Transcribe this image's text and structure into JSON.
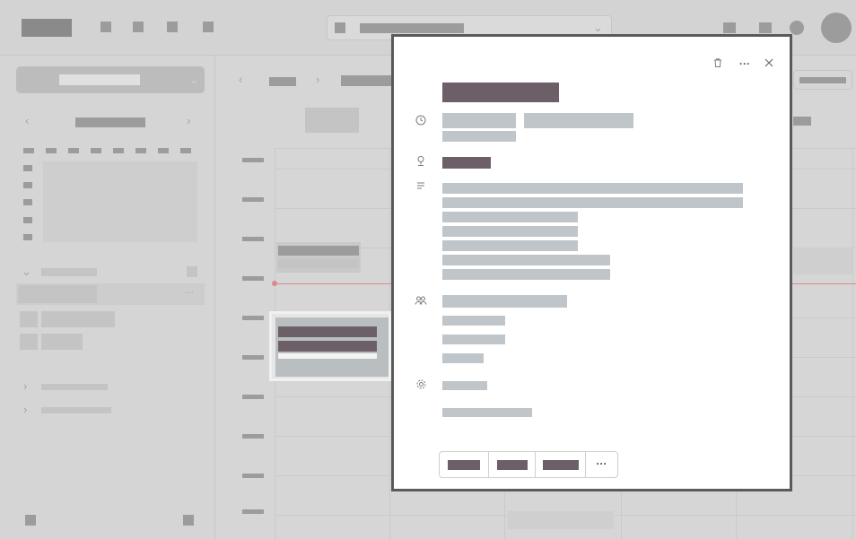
{
  "popup": {
    "header_icons": {
      "delete": "trash-icon",
      "more": "more-icon",
      "close": "close-icon"
    },
    "title": "",
    "time": {
      "icon": "clock-icon",
      "start": "",
      "end": "",
      "recurrence": ""
    },
    "location": {
      "icon": "location-pin-icon",
      "value": ""
    },
    "description": {
      "icon": "notes-icon",
      "lines": [
        "",
        "",
        "",
        "",
        "",
        "",
        ""
      ]
    },
    "attendees": {
      "icon": "people-icon",
      "summary": "",
      "names": [
        "",
        "",
        ""
      ]
    },
    "settings": {
      "icon": "gear-icon",
      "value": "",
      "secondary": ""
    },
    "rsvp": {
      "options": [
        "",
        "",
        ""
      ],
      "more_icon": "more-icon"
    }
  },
  "colors": {
    "accent_dark": "#6c5f67",
    "placeholder": "#bfc5c8",
    "now_line": "#d98b8b"
  }
}
